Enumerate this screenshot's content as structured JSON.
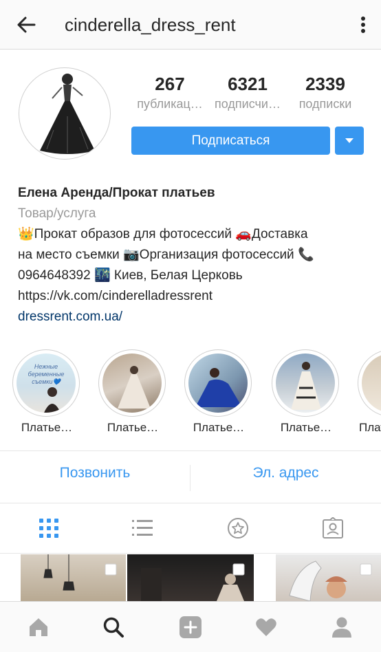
{
  "header": {
    "username": "cinderella_dress_rent",
    "back_icon": "arrow-left-icon",
    "more_icon": "kebab-menu-icon"
  },
  "profile": {
    "stats": [
      {
        "value": "267",
        "label": "публикац…"
      },
      {
        "value": "6321",
        "label": "подписчи…"
      },
      {
        "value": "2339",
        "label": "подписки"
      }
    ],
    "follow_label": "Подписаться",
    "accent_color": "#3897f0"
  },
  "bio": {
    "name": "Елена Аренда/Прокат платьев",
    "category": "Товар/услуга",
    "lines": [
      "👑Прокат образов для фотосессий 🚗Доставка",
      "на место съемки 📷Организация фотосессий 📞",
      "0964648392 🌃 Киев, Белая Церковь",
      "https://vk.com/cinderelladressrent"
    ],
    "website": "dressrent.com.ua/"
  },
  "highlights": [
    {
      "label": "Платье…",
      "overlay_text": "Нежные беременные съемки💙"
    },
    {
      "label": "Платье…"
    },
    {
      "label": "Платье…"
    },
    {
      "label": "Платье…"
    },
    {
      "label": "Плат"
    }
  ],
  "contact": {
    "call_label": "Позвонить",
    "email_label": "Эл. адрес"
  },
  "view_tabs": [
    "grid-icon",
    "list-icon",
    "star-icon",
    "tagged-icon"
  ],
  "bottom_nav": [
    "home-icon",
    "search-icon",
    "add-icon",
    "heart-icon",
    "profile-icon"
  ]
}
